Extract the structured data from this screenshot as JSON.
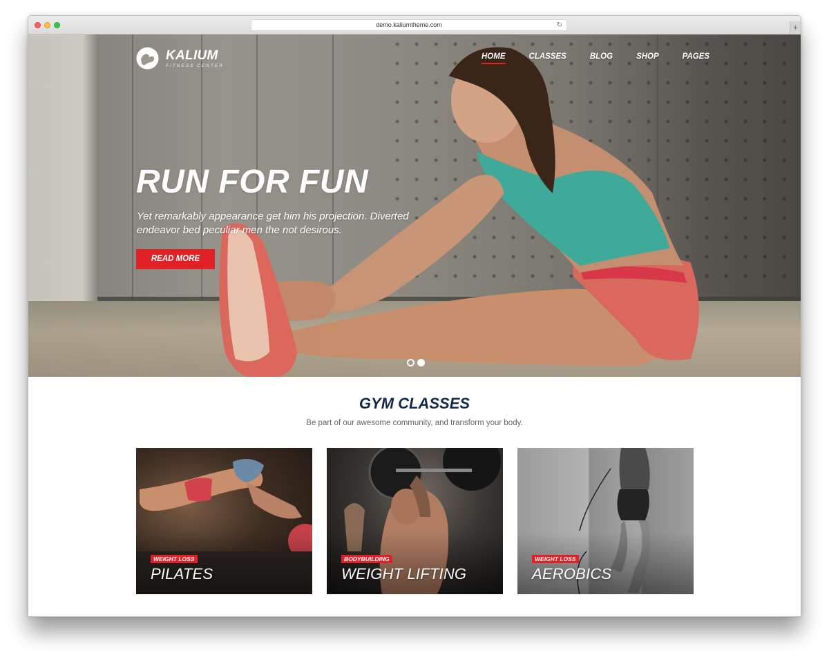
{
  "browser": {
    "url": "demo.kaliumtheme.com",
    "reload_icon": "↻",
    "newtab_icon": "+"
  },
  "site": {
    "logo": {
      "name": "KALIUM",
      "subtitle": "FITNESS CENTER",
      "icon": "flexing-arm-icon"
    },
    "nav": [
      {
        "label": "HOME",
        "active": true
      },
      {
        "label": "CLASSES",
        "active": false
      },
      {
        "label": "BLOG",
        "active": false
      },
      {
        "label": "SHOP",
        "active": false
      },
      {
        "label": "PAGES",
        "active": false
      }
    ],
    "hero": {
      "title": "RUN FOR FUN",
      "text": "Yet remarkably appearance get him his projection. Diverted endeavor bed peculiar men the not desirous.",
      "button": "READ MORE",
      "slides": {
        "count": 2,
        "active_index": 2
      }
    },
    "section": {
      "title": "GYM CLASSES",
      "subtitle": "Be part of our awesome community, and transform your body."
    },
    "cards": [
      {
        "tag": "WEIGHT LOSS",
        "title": "PILATES"
      },
      {
        "tag": "BODYBUILDING",
        "title": "WEIGHT LIFTING"
      },
      {
        "tag": "WEIGHT LOSS",
        "title": "AEROBICS"
      }
    ]
  },
  "colors": {
    "accent": "#e12128",
    "heading": "#13294b",
    "body_text": "#666666"
  }
}
